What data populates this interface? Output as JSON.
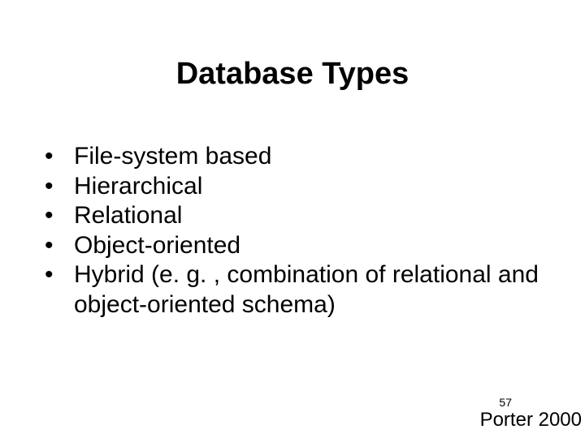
{
  "slide": {
    "title": "Database Types",
    "bullets": [
      "File-system based",
      "Hierarchical",
      "Relational",
      "Object-oriented",
      "Hybrid (e. g. , combination of relational and object-oriented schema)"
    ],
    "page_number": "57",
    "footer": "Porter 2000"
  }
}
